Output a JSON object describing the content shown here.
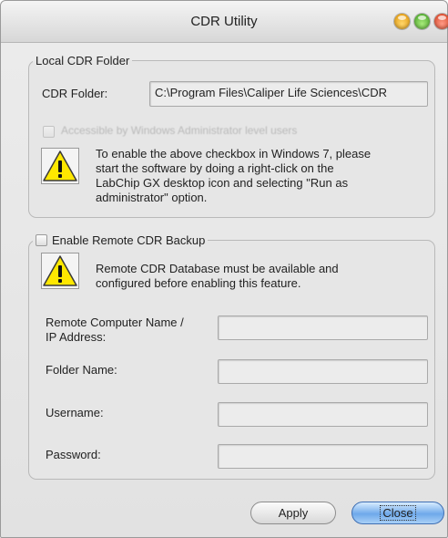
{
  "window": {
    "title": "CDR Utility"
  },
  "local_group": {
    "legend": "Local CDR Folder",
    "folder_label": "CDR Folder:",
    "folder_value": "C:\\Program Files\\Caliper Life Sciences\\CDR",
    "admin_checkbox_label": "Accessible by Windows Administrator level users",
    "admin_checkbox_checked": false,
    "warning_line1": "To enable the above checkbox in Windows 7, please",
    "warning_line2": "start the software by doing a right-click on the",
    "warning_line3": "LabChip GX desktop icon and selecting \"Run as",
    "warning_line4": "administrator\" option."
  },
  "remote_group": {
    "legend": "Enable Remote CDR Backup",
    "enabled": false,
    "warning_line1": "Remote CDR Database must be available and",
    "warning_line2": "configured before enabling this feature.",
    "computer_label_line1": "Remote Computer Name /",
    "computer_label_line2": "IP Address:",
    "computer_value": "",
    "folder_label": "Folder Name:",
    "folder_value": "",
    "username_label": "Username:",
    "username_value": "",
    "password_label": "Password:",
    "password_value": ""
  },
  "buttons": {
    "apply": "Apply",
    "close": "Close"
  },
  "icons": {
    "warning": "warning-icon",
    "minimize": "minimize-icon",
    "zoom": "zoom-icon",
    "close": "close-icon"
  },
  "colors": {
    "close_button": "#6ea9ea",
    "warning_fill": "#ffe800"
  }
}
